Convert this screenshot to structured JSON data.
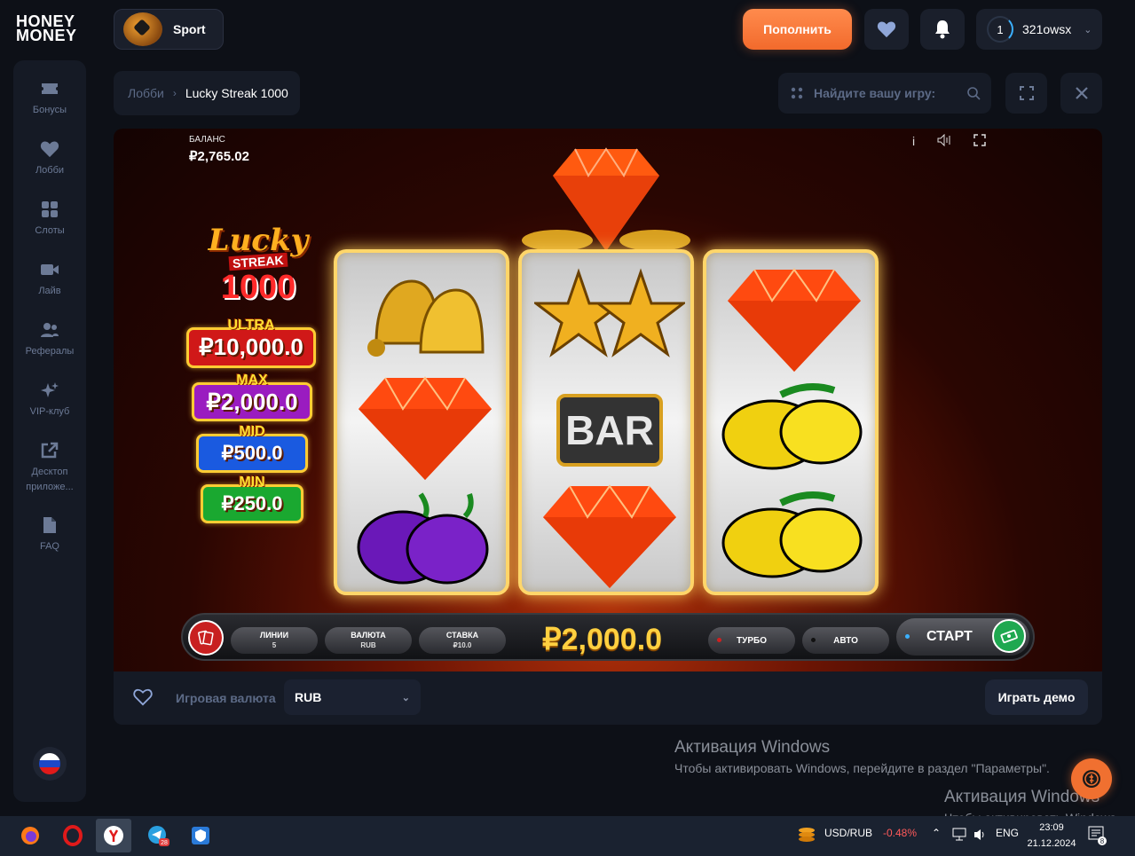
{
  "header": {
    "logo_top": "HONEY",
    "logo_bottom": "MONEY",
    "sport_label": "Sport",
    "deposit_label": "Пополнить",
    "user_level": "1",
    "username": "321owsx"
  },
  "sidebar": {
    "items": [
      {
        "label": "Бонусы",
        "icon": "ticket-icon"
      },
      {
        "label": "Лобби",
        "icon": "heart-icon"
      },
      {
        "label": "Слоты",
        "icon": "grid-icon"
      },
      {
        "label": "Лайв",
        "icon": "video-icon"
      },
      {
        "label": "Рефералы",
        "icon": "users-icon"
      },
      {
        "label": "VIP-клуб",
        "icon": "sparkle-icon"
      },
      {
        "label": "Десктоп приложе...",
        "icon": "external-link-icon"
      },
      {
        "label": "FAQ",
        "icon": "document-icon"
      }
    ]
  },
  "breadcrumb": {
    "lobby": "Лобби",
    "current": "Lucky Streak 1000"
  },
  "search": {
    "placeholder": "Найдите вашу игру:"
  },
  "game": {
    "balance_label": "БАЛАНС",
    "balance_value": "₽2,765.02",
    "info_label": "i",
    "logo_lucky": "Lucky",
    "logo_streak": "STREAK",
    "logo_1000": "1000",
    "jackpots": [
      {
        "name": "ULTRA",
        "value": "₽10,000.0",
        "color": "#d01818"
      },
      {
        "name": "MAX",
        "value": "₽2,000.0",
        "color": "#9a1cc0"
      },
      {
        "name": "MID",
        "value": "₽500.0",
        "color": "#1a5ae0"
      },
      {
        "name": "MIN",
        "value": "₽250.0",
        "color": "#1aa830"
      }
    ],
    "reels": [
      [
        "bell",
        "diamond",
        "plum"
      ],
      [
        "star",
        "bar",
        "diamond"
      ],
      [
        "diamond",
        "lemon",
        "lemon"
      ]
    ],
    "bar_symbol_text": "BAR",
    "controls": {
      "lines_label": "ЛИНИИ",
      "lines_value": "5",
      "currency_label": "ВАЛЮТА",
      "currency_value": "RUB",
      "bet_label": "СТАВКА",
      "bet_value": "₽10.0",
      "win_value": "₽2,000.0",
      "turbo_label": "ТУРБО",
      "auto_label": "АВТО",
      "start_label": "СТАРТ"
    }
  },
  "under_bar": {
    "currency_label": "Игровая валюта",
    "currency_value": "RUB",
    "demo_label": "Играть демо"
  },
  "watermark": {
    "title": "Активация Windows",
    "subtitle": "Чтобы активировать Windows, перейдите в раздел \"Параметры\".",
    "title2": "Активация Windows",
    "subtitle2": "Чтобы активировать Windows,"
  },
  "taskbar": {
    "currency_pair": "USD/RUB",
    "currency_change": "-0.48%",
    "language": "ENG",
    "time": "23:09",
    "date": "21.12.2024",
    "telegram_badge": "28",
    "notif_badge": "8"
  },
  "colors": {
    "accent": "#f26a2c",
    "background": "#0d1017",
    "panel": "#151a25",
    "negative": "#ff5a5a"
  }
}
